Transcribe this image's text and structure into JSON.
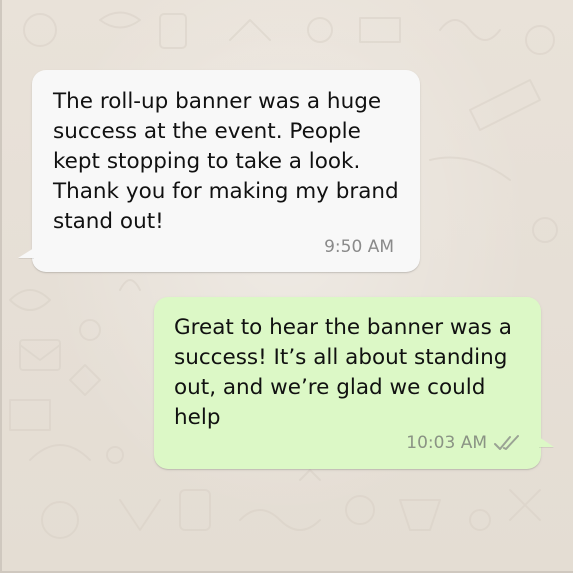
{
  "theme": {
    "background": "#ece5dd",
    "incoming_bubble": "#f8f8f8",
    "outgoing_bubble": "#dcf8c6",
    "timestamp_color": "#8a8a8a",
    "tick_color": "#8a9384"
  },
  "messages": [
    {
      "direction": "incoming",
      "text": "The roll-up banner was a huge success at the event. People kept stopping to take a look. Thank you for making my brand stand out!",
      "time": "9:50 AM"
    },
    {
      "direction": "outgoing",
      "text": "Great to hear the banner was a success! It’s all about standing out, and we’re glad we could help",
      "time": "10:03 AM",
      "status_icon": "double-check-icon"
    }
  ]
}
